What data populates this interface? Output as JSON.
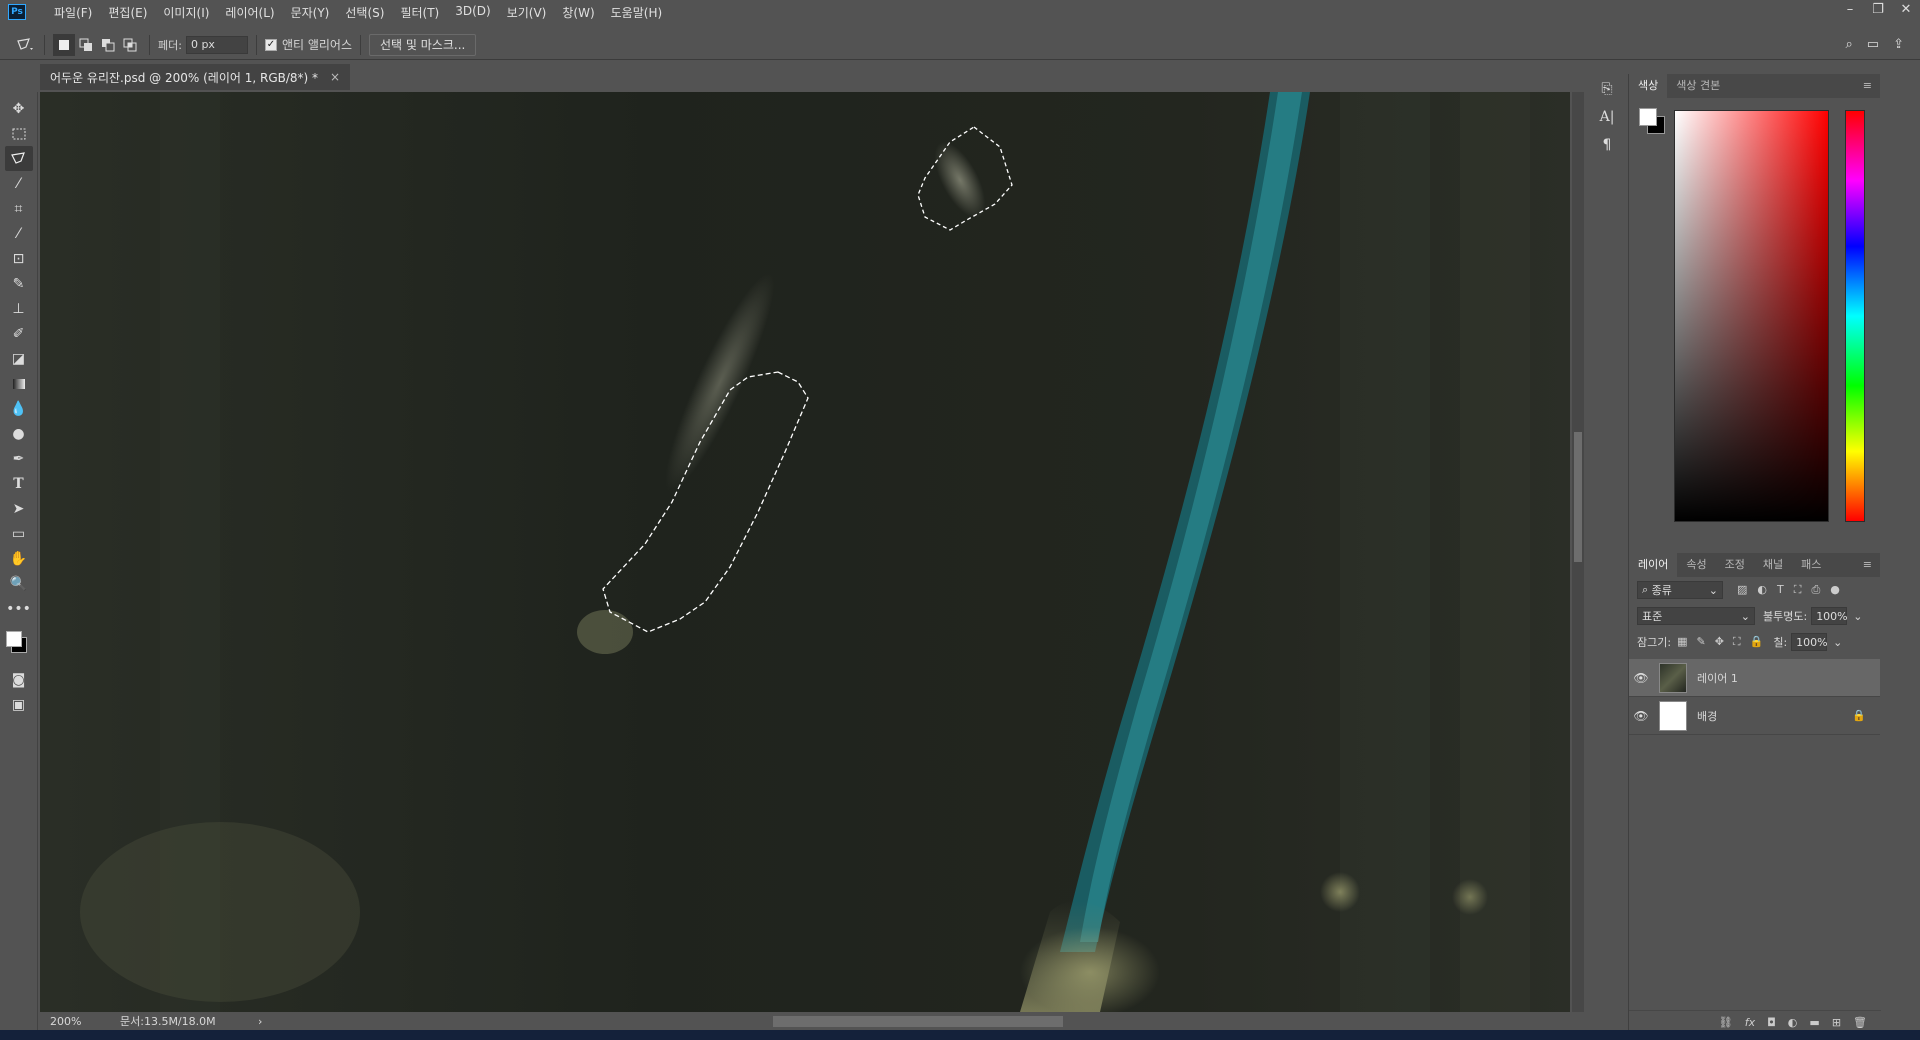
{
  "app": {
    "logo": "Ps",
    "menus": [
      "파일(F)",
      "편집(E)",
      "이미지(I)",
      "레이어(L)",
      "문자(Y)",
      "선택(S)",
      "필터(T)",
      "3D(D)",
      "보기(V)",
      "창(W)",
      "도움말(H)"
    ],
    "window_controls": [
      "–",
      "❐",
      "✕"
    ]
  },
  "options": {
    "feather_label": "페더:",
    "feather_value": "0 px",
    "antialias_label": "앤티 앨리어스",
    "antialias_checked": true,
    "select_mask_label": "선택 및 마스크..."
  },
  "document": {
    "tab_title": "어두운 유리잔.psd @ 200% (레이어 1, RGB/8*) *",
    "close": "×"
  },
  "status": {
    "zoom": "200%",
    "doc_size": "문서:13.5M/18.0M",
    "arrow": "›"
  },
  "tools": [
    "move-tool",
    "marquee-tool",
    "polygonal-lasso-tool",
    "magic-wand-tool",
    "crop-tool",
    "eyedropper-tool",
    "patch-tool",
    "brush-tool",
    "clone-stamp-tool",
    "history-brush-tool",
    "eraser-tool",
    "gradient-tool",
    "blur-tool",
    "dodge-tool",
    "pen-tool",
    "type-tool",
    "path-selection-tool",
    "rectangle-tool",
    "hand-tool",
    "zoom-tool",
    "more-tools"
  ],
  "color_panel": {
    "tabs": [
      "색상",
      "색상 견본"
    ],
    "foreground": "#ffffff",
    "background": "#000000"
  },
  "layers_panel": {
    "tabs": [
      "레이어",
      "속성",
      "조정",
      "채널",
      "패스"
    ],
    "filter_label": "종류",
    "blend_mode": "표준",
    "opacity_label": "불투명도:",
    "opacity_value": "100%",
    "lock_label": "잠그기:",
    "fill_label": "칠:",
    "fill_value": "100%",
    "layers": [
      {
        "name": "레이어 1",
        "selected": true,
        "locked": false
      },
      {
        "name": "배경",
        "selected": false,
        "locked": true
      }
    ]
  }
}
